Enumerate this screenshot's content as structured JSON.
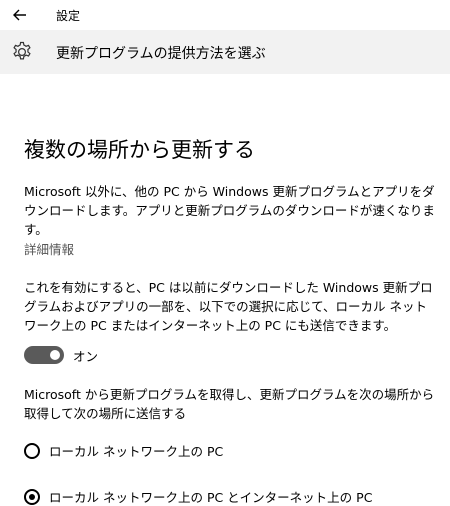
{
  "titlebar": {
    "back_icon": "back-arrow-icon",
    "label": "設定"
  },
  "page": {
    "icon": "gear-icon",
    "title": "更新プログラムの提供方法を選ぶ"
  },
  "section": {
    "title": "複数の場所から更新する",
    "description": "Microsoft 以外に、他の PC から Windows 更新プログラムとアプリをダウンロードします。アプリと更新プログラムのダウンロードが速くなります。",
    "more_info_link": "詳細情報",
    "enable_text": "これを有効にすると、PC は以前にダウンロードした Windows 更新プログラムおよびアプリの一部を、以下での選択に応じて、ローカル ネットワーク上の PC またはインターネット上の PC にも送信できます。",
    "toggle": {
      "state": "on",
      "label": "オン"
    },
    "choice_text": "Microsoft から更新プログラムを取得し、更新プログラムを次の場所から取得して次の場所に送信する",
    "options": [
      {
        "label": "ローカル ネットワーク上の PC",
        "selected": false
      },
      {
        "label": "ローカル ネットワーク上の PC とインターネット上の PC",
        "selected": true
      }
    ]
  }
}
